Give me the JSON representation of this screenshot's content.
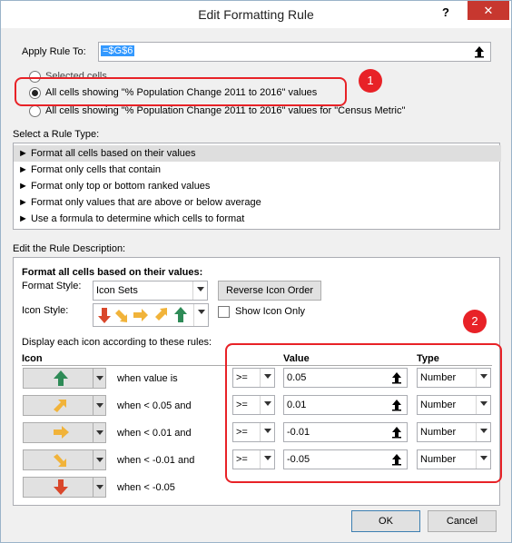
{
  "window": {
    "title": "Edit Formatting Rule",
    "help": "?",
    "close": "✕"
  },
  "apply_rule": {
    "label": "Apply Rule To:",
    "value": "=$G$6"
  },
  "scope_options": [
    {
      "label": "Selected cells",
      "selected": false
    },
    {
      "label": "All cells showing \"% Population Change 2011 to 2016\" values",
      "selected": true
    },
    {
      "label": "All cells showing \"% Population Change 2011 to 2016\" values for \"Census Metric\"",
      "selected": false
    }
  ],
  "rule_type": {
    "label": "Select a Rule Type:",
    "items": [
      "► Format all cells based on their values",
      "► Format only cells that contain",
      "► Format only top or bottom ranked values",
      "► Format only values that are above or below average",
      "► Use a formula to determine which cells to format"
    ]
  },
  "description": {
    "label": "Edit the Rule Description:",
    "heading": "Format all cells based on their values:",
    "format_style_label": "Format Style:",
    "format_style_value": "Icon Sets",
    "reverse_button": "Reverse Icon Order",
    "icon_style_label": "Icon Style:",
    "show_icon_only": "Show Icon Only",
    "display_rules_label": "Display each icon according to these rules:",
    "icon_header": "Icon",
    "value_header": "Value",
    "type_header": "Type"
  },
  "rules": [
    {
      "icon": "green-up-arrow-icon",
      "color": "#2e8b57",
      "text": "when value is",
      "operator": ">=",
      "value": "0.05",
      "type": "Number"
    },
    {
      "icon": "yellow-up-right-arrow-icon",
      "color": "#f1b33a",
      "text": "when < 0.05 and",
      "operator": ">=",
      "value": "0.01",
      "type": "Number"
    },
    {
      "icon": "yellow-right-arrow-icon",
      "color": "#f1b33a",
      "text": "when < 0.01 and",
      "operator": ">=",
      "value": "-0.01",
      "type": "Number"
    },
    {
      "icon": "yellow-down-right-arrow-icon",
      "color": "#f1b33a",
      "text": "when < -0.01 and",
      "operator": ">=",
      "value": "-0.05",
      "type": "Number"
    },
    {
      "icon": "red-down-arrow-icon",
      "color": "#d9472b",
      "text": "when < -0.05"
    }
  ],
  "annotations": [
    "1",
    "2"
  ],
  "buttons": {
    "ok": "OK",
    "cancel": "Cancel"
  }
}
